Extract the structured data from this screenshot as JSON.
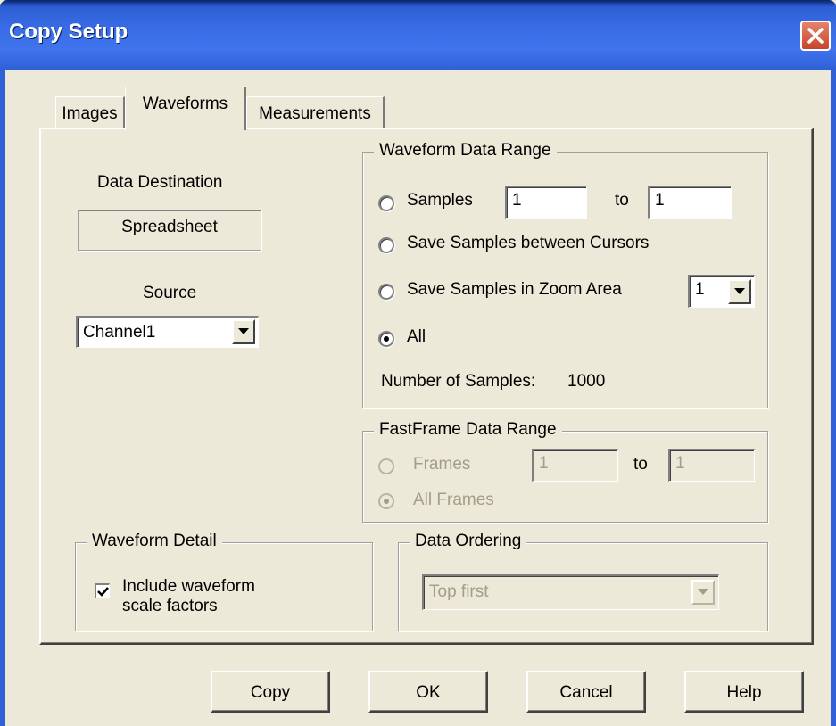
{
  "window": {
    "title": "Copy Setup"
  },
  "tabs": [
    {
      "label": "Images"
    },
    {
      "label": "Waveforms"
    },
    {
      "label": "Measurements"
    }
  ],
  "destination": {
    "heading": "Data Destination",
    "value": "Spreadsheet"
  },
  "source": {
    "heading": "Source",
    "selected": "Channel1"
  },
  "waveform_range": {
    "title": "Waveform Data Range",
    "samples_label": "Samples",
    "from": "1",
    "to_label": "to",
    "to": "1",
    "between_cursors_label": "Save Samples between Cursors",
    "zoom_label": "Save Samples in Zoom Area",
    "zoom_selected": "1",
    "all_label": "All",
    "num_samples_label": "Number of Samples:",
    "num_samples_value": "1000",
    "selected_option": "All"
  },
  "fastframe": {
    "title": "FastFrame Data Range",
    "frames_label": "Frames",
    "from": "1",
    "to_label": "to",
    "to": "1",
    "all_frames_label": "All Frames"
  },
  "waveform_detail": {
    "title": "Waveform Detail",
    "include_line1": "Include waveform",
    "include_line2": "scale factors",
    "checked": true
  },
  "data_ordering": {
    "title": "Data Ordering",
    "selected": "Top first"
  },
  "buttons": {
    "copy": "Copy",
    "ok": "OK",
    "cancel": "Cancel",
    "help": "Help"
  },
  "colors": {
    "titlebar": "#3a6ee8",
    "face": "#ece9d8",
    "close": "#c6452b",
    "disabled_text": "#a39e8a"
  }
}
